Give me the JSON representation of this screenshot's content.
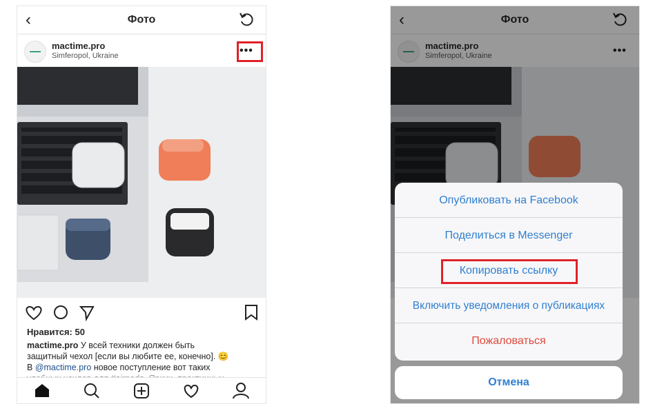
{
  "screen_left": {
    "nav": {
      "back_icon": "chevron-left-icon",
      "title": "Фото",
      "refresh_icon": "refresh-icon"
    },
    "post": {
      "username": "mactime.pro",
      "location": "Simferopol, Ukraine",
      "more_icon": "more-dots-icon",
      "more_label": "•••",
      "likes": "Нравится: 50",
      "caption_user": "mactime.pro",
      "caption_line1": " У всей техники должен быть",
      "caption_line2": "защитный чехол [если вы любите ее, конечно].",
      "caption_emoji": "😊",
      "caption_line3_prefix": "В ",
      "caption_mention": "@mactime.pro",
      "caption_line3_suffix": " новое поступление вот таких",
      "caption_line4": "удобных чехлов для #airpods. Ярких, практичных"
    },
    "tabbar": {
      "items": [
        "home-icon",
        "search-icon",
        "add-post-icon",
        "heart-icon",
        "profile-icon"
      ]
    }
  },
  "screen_right": {
    "nav": {
      "title": "Фото"
    },
    "post": {
      "username": "mactime.pro",
      "location": "Simferopol, Ukraine",
      "more_label": "•••"
    },
    "action_sheet": {
      "items": [
        "Опубликовать на Facebook",
        "Поделиться в Messenger",
        "Копировать ссылку",
        "Включить уведомления о публикациях",
        "Пожаловаться"
      ],
      "cancel_label": "Отмена"
    }
  },
  "colors": {
    "highlight": "#e0202a",
    "sheet_text": "#2f7fd0",
    "danger_text": "#e0483b"
  }
}
